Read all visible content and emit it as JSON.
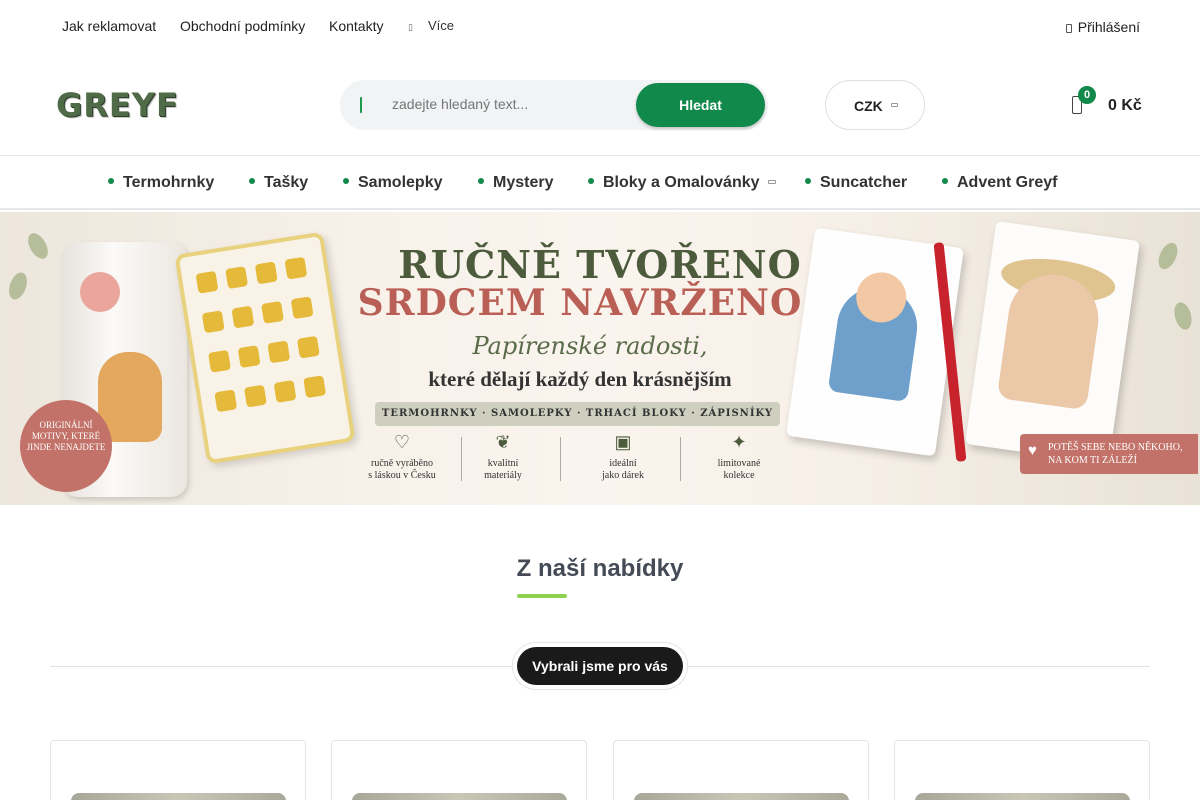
{
  "topbar": {
    "links": [
      "Jak reklamovat",
      "Obchodní podmínky",
      "Kontakty"
    ],
    "more_label": "Více",
    "login_label": "Přihlášení"
  },
  "header": {
    "logo_text": "GREYF",
    "search": {
      "placeholder": "zadejte hledaný text...",
      "button_label": "Hledat"
    },
    "currency": "CZK",
    "cart": {
      "count": "0",
      "total": "0 Kč"
    }
  },
  "nav": {
    "items": [
      {
        "label": "Termohrnky"
      },
      {
        "label": "Tašky"
      },
      {
        "label": "Samolepky"
      },
      {
        "label": "Mystery"
      },
      {
        "label": "Bloky a Omalovánky",
        "has_submenu": true
      },
      {
        "label": "Suncatcher"
      },
      {
        "label": "Advent Greyf"
      }
    ]
  },
  "hero": {
    "title_line1": "RUČNĚ TVOŘENO",
    "title_line2": "SRDCEM NAVRŽENO",
    "script": "Papírenské radosti,",
    "tagline": "které dělají každý den krásnějším",
    "categories_strip": "TERMOHRNKY · SAMOLEPKY · TRHACÍ BLOKY · ZÁPISNÍKY",
    "features": [
      {
        "line1": "ručně vyráběno",
        "line2": "s láskou v Česku",
        "icon": "hand-heart-icon"
      },
      {
        "line1": "kvalitní",
        "line2": "materiály",
        "icon": "leaf-icon"
      },
      {
        "line1": "ideální",
        "line2": "jako dárek",
        "icon": "gift-icon"
      },
      {
        "line1": "limitované",
        "line2": "kolekce",
        "icon": "sparkle-icon"
      }
    ],
    "badge_text": "ORIGINÁLNÍ MOTIVY, KTERÉ JINDE NENAJDETE",
    "ribbon_line1": "POTĚŠ SEBE NEBO NĚKOHO,",
    "ribbon_line2": "NA KOM TI ZÁLEŽÍ"
  },
  "section": {
    "title": "Z naší nabídky",
    "tab_label": "Vybrali jsme pro vás"
  },
  "colors": {
    "brand_green": "#11894a",
    "accent_lime": "#8fd14f",
    "logo_green": "#4f6b47",
    "dark_pill": "#1a1a1a"
  }
}
